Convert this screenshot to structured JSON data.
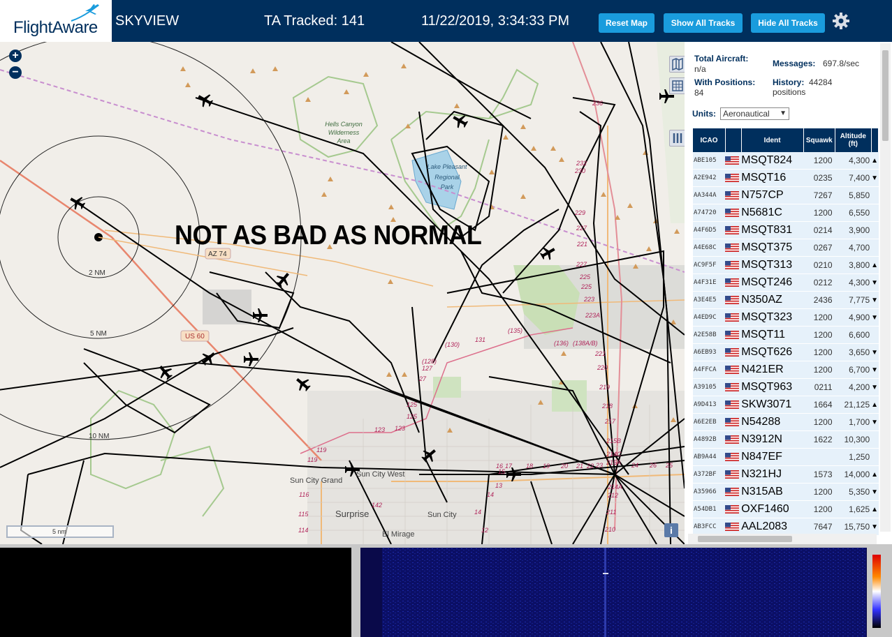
{
  "header": {
    "logo_text": "FlightAware",
    "app_name": "SKYVIEW",
    "tracked_label": "TA Tracked: 141",
    "datetime": "11/22/2019, 3:34:33 PM",
    "reset_map": "Reset Map",
    "show_all_tracks": "Show All Tracks",
    "hide_all_tracks": "Hide All Tracks",
    "settings_icon": "gear-icon"
  },
  "map": {
    "overlay_caption": "NOT AS BAD AS NORMAL",
    "scale_label": "5 nm",
    "range_rings": [
      "2 NM",
      "5 NM",
      "10 NM"
    ],
    "place_labels": [
      "Hells Canyon Wilderness Area",
      "Lake Pleasant Regional Park",
      "Sun City Grand",
      "Sun City West",
      "Surprise",
      "Sun City",
      "El Mirage"
    ],
    "road_shields": [
      "AZ 74",
      "US 60"
    ],
    "zoom_in": "+",
    "zoom_out": "−",
    "info_button": "i",
    "route_numbers": [
      "236",
      "232",
      "230",
      "229",
      "227",
      "225",
      "225",
      "223",
      "223A",
      "221",
      "220",
      "219",
      "218",
      "217",
      "215B",
      "215A",
      "214C",
      "214A",
      "212",
      "211",
      "210",
      "131",
      "(130)",
      "(135)",
      "(136)",
      "(138A/B)",
      "(128)",
      "127",
      "27",
      "125",
      "125",
      "123",
      "123",
      "119",
      "119",
      "116",
      "115",
      "114",
      "142",
      "16",
      "17",
      "18",
      "19",
      "20",
      "21",
      "22",
      "23",
      "24",
      "26",
      "25",
      "12",
      "14",
      "13",
      "15",
      "14"
    ]
  },
  "panel": {
    "total_aircraft_label": "Total Aircraft:",
    "total_aircraft_value": "n/a",
    "with_positions_label": "With Positions:",
    "with_positions_value": "84",
    "messages_label": "Messages:",
    "messages_value": "697.8/sec",
    "history_label": "History:",
    "history_value": "44284 positions",
    "units_label": "Units:",
    "units_value": "Aeronautical",
    "columns": [
      "ICAO",
      "",
      "Ident",
      "Squawk",
      "Altitude (ft)",
      ""
    ]
  },
  "aircraft": [
    {
      "icao": "ABE105",
      "ident": "MSQT824",
      "squawk": "1200",
      "alt": "4,300",
      "trend": "▲"
    },
    {
      "icao": "A2E942",
      "ident": "MSQT16",
      "squawk": "0235",
      "alt": "7,400",
      "trend": "▼"
    },
    {
      "icao": "AA344A",
      "ident": "N757CP",
      "squawk": "7267",
      "alt": "5,850",
      "trend": ""
    },
    {
      "icao": "A74720",
      "ident": "N5681C",
      "squawk": "1200",
      "alt": "6,550",
      "trend": ""
    },
    {
      "icao": "A4F6D5",
      "ident": "MSQT831",
      "squawk": "0214",
      "alt": "3,900",
      "trend": ""
    },
    {
      "icao": "A4E68C",
      "ident": "MSQT375",
      "squawk": "0267",
      "alt": "4,700",
      "trend": ""
    },
    {
      "icao": "AC9F5F",
      "ident": "MSQT313",
      "squawk": "0210",
      "alt": "3,800",
      "trend": "▲"
    },
    {
      "icao": "A4F31E",
      "ident": "MSQT246",
      "squawk": "0212",
      "alt": "4,300",
      "trend": "▼"
    },
    {
      "icao": "A3E4E5",
      "ident": "N350AZ",
      "squawk": "2436",
      "alt": "7,775",
      "trend": "▼"
    },
    {
      "icao": "A4ED9C",
      "ident": "MSQT323",
      "squawk": "1200",
      "alt": "4,900",
      "trend": "▼"
    },
    {
      "icao": "A2E58B",
      "ident": "MSQT11",
      "squawk": "1200",
      "alt": "6,600",
      "trend": ""
    },
    {
      "icao": "A6EB93",
      "ident": "MSQT626",
      "squawk": "1200",
      "alt": "3,650",
      "trend": "▼"
    },
    {
      "icao": "A4FFCA",
      "ident": "N421ER",
      "squawk": "1200",
      "alt": "6,700",
      "trend": "▼"
    },
    {
      "icao": "A39105",
      "ident": "MSQT963",
      "squawk": "0211",
      "alt": "4,200",
      "trend": "▼"
    },
    {
      "icao": "A9D413",
      "ident": "SKW3071",
      "squawk": "1664",
      "alt": "21,125",
      "trend": "▲"
    },
    {
      "icao": "A6E2EB",
      "ident": "N54288",
      "squawk": "1200",
      "alt": "1,700",
      "trend": "▼"
    },
    {
      "icao": "A4892B",
      "ident": "N3912N",
      "squawk": "1622",
      "alt": "10,300",
      "trend": ""
    },
    {
      "icao": "AB9A44",
      "ident": "N847EF",
      "squawk": "",
      "alt": "1,250",
      "trend": ""
    },
    {
      "icao": "A372BF",
      "ident": "N321HJ",
      "squawk": "1573",
      "alt": "14,000",
      "trend": "▲"
    },
    {
      "icao": "A35966",
      "ident": "N315AB",
      "squawk": "1200",
      "alt": "5,350",
      "trend": "▼"
    },
    {
      "icao": "A54DB1",
      "ident": "OXF1460",
      "squawk": "1200",
      "alt": "1,625",
      "trend": "▲"
    },
    {
      "icao": "AB3FCC",
      "ident": "AAL2083",
      "squawk": "7647",
      "alt": "15,750",
      "trend": "▼"
    }
  ]
}
